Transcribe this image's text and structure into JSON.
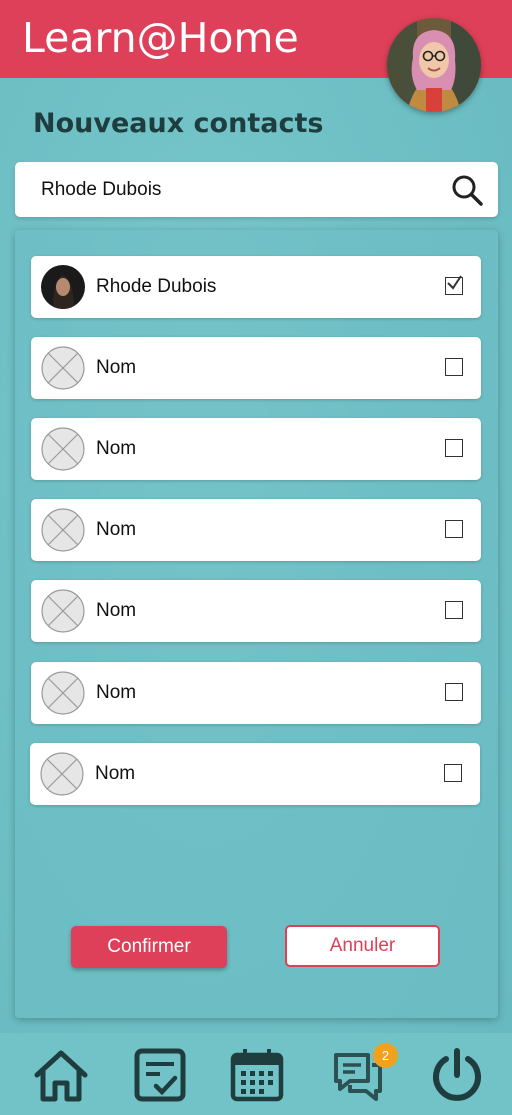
{
  "app": {
    "title": "Learn@Home"
  },
  "page": {
    "title": "Nouveaux contacts"
  },
  "search": {
    "value": "Rhode Dubois"
  },
  "contacts": [
    {
      "name": "Rhode Dubois",
      "checked": true
    },
    {
      "name": "Nom",
      "checked": false
    },
    {
      "name": "Nom",
      "checked": false
    },
    {
      "name": "Nom",
      "checked": false
    },
    {
      "name": "Nom",
      "checked": false
    },
    {
      "name": "Nom",
      "checked": false
    },
    {
      "name": "Nom",
      "checked": false
    }
  ],
  "actions": {
    "confirm_label": "Confirmer",
    "cancel_label": "Annuler"
  },
  "nav": {
    "items": [
      {
        "icon": "home-icon"
      },
      {
        "icon": "tasks-icon"
      },
      {
        "icon": "calendar-icon"
      },
      {
        "icon": "chat-icon",
        "badge": "2"
      },
      {
        "icon": "power-icon"
      }
    ]
  },
  "colors": {
    "brand": "#dd4058",
    "background": "#71c3c8",
    "badge": "#f0a11e",
    "nav_icon": "#1f3d3e"
  }
}
